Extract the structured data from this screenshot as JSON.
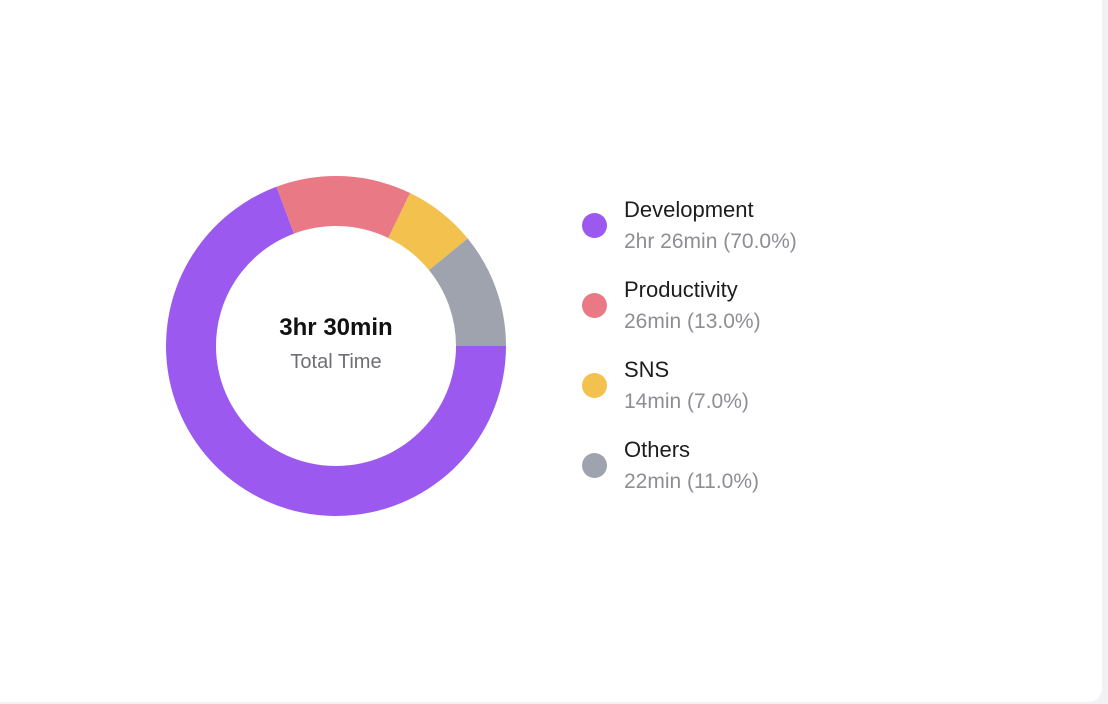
{
  "chart_data": {
    "type": "pie",
    "style": "donut",
    "center": {
      "total": "3hr 30min",
      "caption": "Total Time"
    },
    "slices": [
      {
        "name": "Development",
        "label": "2hr 26min (70.0%)",
        "minutes": 146,
        "percent": 70.0,
        "color": "#9b59ef"
      },
      {
        "name": "Productivity",
        "label": "26min (13.0%)",
        "minutes": 26,
        "percent": 13.0,
        "color": "#e97a85"
      },
      {
        "name": "SNS",
        "label": "14min (7.0%)",
        "minutes": 14,
        "percent": 7.0,
        "color": "#f2c14e"
      },
      {
        "name": "Others",
        "label": "22min (11.0%)",
        "minutes": 22,
        "percent": 11.0,
        "color": "#9ea3ad"
      }
    ],
    "start_direction": "right",
    "legend_position": "right"
  }
}
